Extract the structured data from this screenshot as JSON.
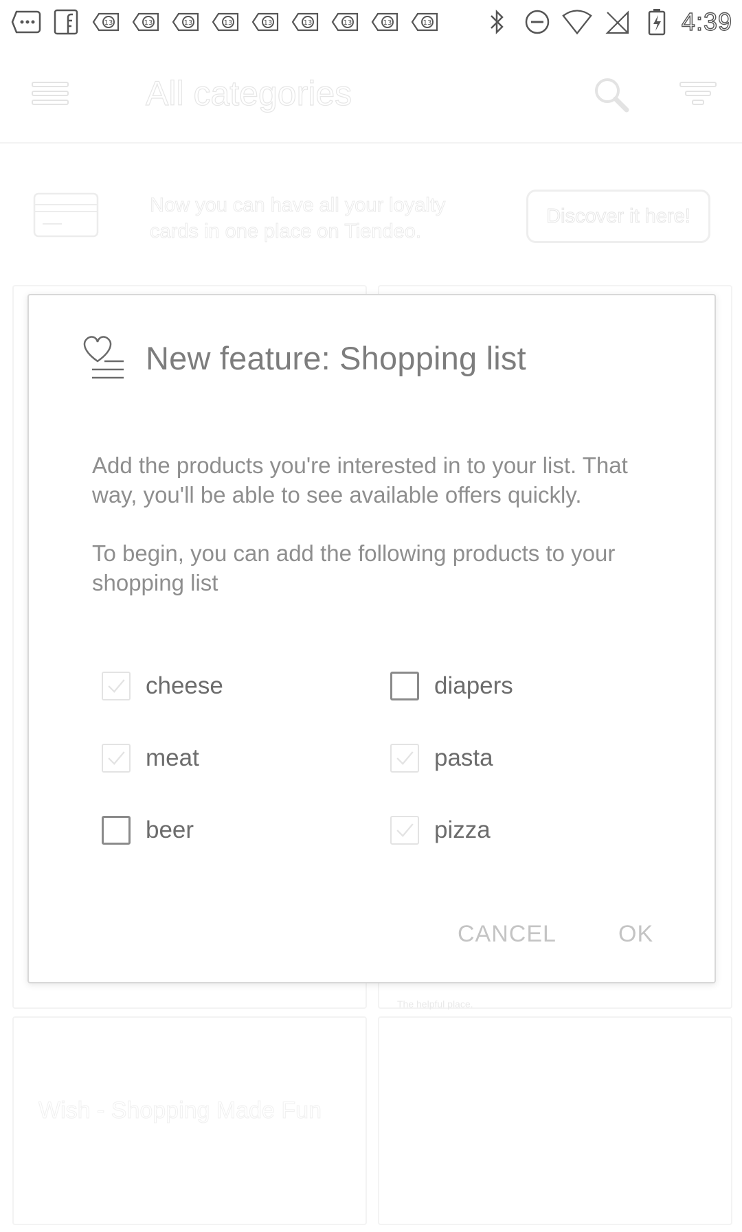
{
  "status_bar": {
    "time": "4:39",
    "left_icons": [
      "more-notifications-icon",
      "facebook-icon",
      "app-13-icon",
      "app-13-icon",
      "app-13-icon",
      "app-13-icon",
      "app-13-icon",
      "app-13-icon",
      "app-13-icon",
      "app-13-icon",
      "app-13-icon"
    ],
    "right_icons": [
      "bluetooth-icon",
      "do-not-disturb-icon",
      "wifi-icon",
      "no-signal-icon",
      "battery-charging-icon"
    ]
  },
  "app_bar": {
    "title": "All categories",
    "icons": [
      "menu-icon",
      "search-icon",
      "filter-icon"
    ]
  },
  "loyalty_banner": {
    "text": "Now you can have all your loyalty cards in one place on Tiendeo.",
    "button_label": "Discover it here!"
  },
  "background": {
    "store_name": "Wish - Shopping Made Fun",
    "tagline": "The helpful place."
  },
  "dialog": {
    "icon": "shopping-list-heart-icon",
    "title": "New feature: Shopping list",
    "body_1": "Add the products you're interested in to your list. That way, you'll be able to see available offers quickly.",
    "body_2": "To begin, you can add the following products to your shopping list",
    "options": [
      {
        "label": "cheese",
        "checked": true
      },
      {
        "label": "diapers",
        "checked": false
      },
      {
        "label": "meat",
        "checked": true
      },
      {
        "label": "pasta",
        "checked": true
      },
      {
        "label": "beer",
        "checked": false
      },
      {
        "label": "pizza",
        "checked": true
      }
    ],
    "cancel_label": "CANCEL",
    "ok_label": "OK"
  },
  "colors": {
    "text_primary": "#6c6c6c",
    "text_secondary": "#8e8e8e",
    "action_text": "#c4c4c4",
    "checkbox_border": "#8a8a8a"
  }
}
